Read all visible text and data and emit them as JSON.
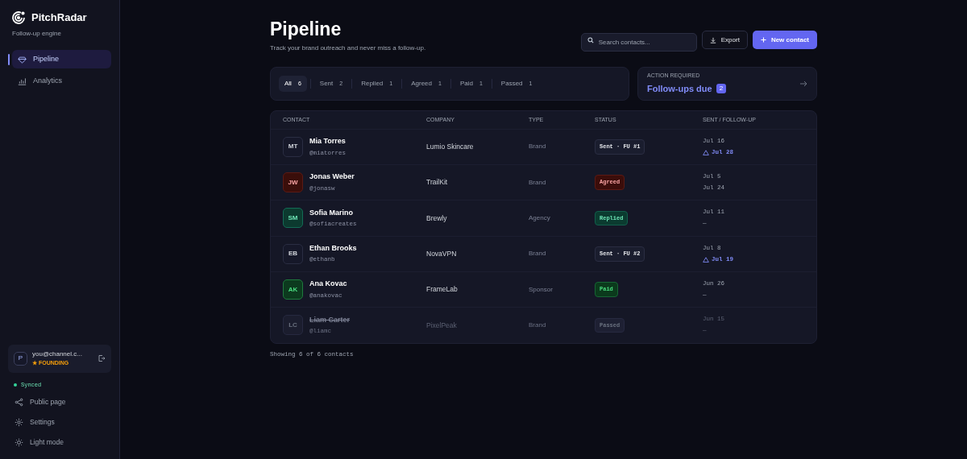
{
  "brand": {
    "name": "PitchRadar",
    "tagline": "Follow-up engine"
  },
  "nav": [
    {
      "label": "Pipeline",
      "selected": true
    },
    {
      "label": "Analytics",
      "selected": false
    }
  ],
  "account": {
    "avatar": "P",
    "email": "you@channel.c...",
    "plan": "★ FOUNDING"
  },
  "sync_status": "Synced",
  "footer_links": [
    {
      "label": "Public page"
    },
    {
      "label": "Settings"
    },
    {
      "label": "Light mode"
    }
  ],
  "page": {
    "title": "Pipeline",
    "subtitle": "Track your brand outreach and never miss a follow-up."
  },
  "search": {
    "placeholder": "Search contacts..."
  },
  "buttons": {
    "export": "Export",
    "new_contact": "New contact"
  },
  "filters": [
    {
      "label": "All",
      "count": "6",
      "selected": true
    },
    {
      "label": "Sent",
      "count": "2",
      "selected": false
    },
    {
      "label": "Replied",
      "count": "1",
      "selected": false
    },
    {
      "label": "Agreed",
      "count": "1",
      "selected": false
    },
    {
      "label": "Paid",
      "count": "1",
      "selected": false
    },
    {
      "label": "Passed",
      "count": "1",
      "selected": false
    }
  ],
  "action_required": {
    "label": "ACTION REQUIRED",
    "title": "Follow-ups due",
    "count": "2"
  },
  "table": {
    "columns": [
      "CONTACT",
      "COMPANY",
      "TYPE",
      "STATUS",
      "SENT / FOLLOW-UP"
    ],
    "rows": [
      {
        "initials": "MT",
        "name": "Mia Torres",
        "handle": "@miatorres",
        "company": "Lumio Skincare",
        "type": "Brand",
        "status": "Sent · FU #1",
        "kind": "sent",
        "sent": "Jul 16",
        "follow_up": "Jul 28",
        "overdue": true
      },
      {
        "initials": "JW",
        "name": "Jonas Weber",
        "handle": "@jonasw",
        "company": "TrailKit",
        "type": "Brand",
        "status": "Agreed",
        "kind": "agreed",
        "sent": "Jul 5",
        "follow_up": "Jul 24",
        "overdue": false
      },
      {
        "initials": "SM",
        "name": "Sofia Marino",
        "handle": "@sofiacreates",
        "company": "Brewly",
        "type": "Agency",
        "status": "Replied",
        "kind": "replied",
        "sent": "Jul 11",
        "follow_up": "—",
        "overdue": false
      },
      {
        "initials": "EB",
        "name": "Ethan Brooks",
        "handle": "@ethanb",
        "company": "NovaVPN",
        "type": "Brand",
        "status": "Sent · FU #2",
        "kind": "sent",
        "sent": "Jul 8",
        "follow_up": "Jul 19",
        "overdue": true
      },
      {
        "initials": "AK",
        "name": "Ana Kovac",
        "handle": "@anakovac",
        "company": "FrameLab",
        "type": "Sponsor",
        "status": "Paid",
        "kind": "paid",
        "sent": "Jun 26",
        "follow_up": "—",
        "overdue": false
      },
      {
        "initials": "LC",
        "name": "Liam Carter",
        "handle": "@liamc",
        "company": "PixelPeak",
        "type": "Brand",
        "status": "Passed",
        "kind": "passed",
        "sent": "Jun 15",
        "follow_up": "—",
        "overdue": false
      }
    ]
  },
  "footer_note": "Showing 6 of 6 contacts"
}
